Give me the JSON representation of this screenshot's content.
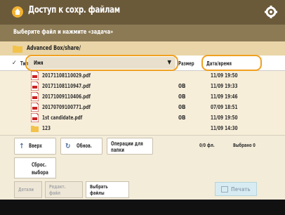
{
  "header": {
    "title": "Доступ к сохр. файлам"
  },
  "subheader": {
    "instruction": "Выберите файл и нажмите «задача»"
  },
  "path": {
    "text": "Advanced Box/share/"
  },
  "columns": {
    "type": "Тип",
    "name": "Имя",
    "sort_arrow": "▼",
    "size": "Размер",
    "date": "Дата/время"
  },
  "files": [
    {
      "name": "20171108110029.pdf",
      "size": "",
      "date": "11/09 19:50",
      "icon": "pdf-file-icon"
    },
    {
      "name": "20171108110947.pdf",
      "size": "0B",
      "date": "11/09 19:33",
      "icon": "pdf-file-icon"
    },
    {
      "name": "20171009110406.pdf",
      "size": "0B",
      "date": "11/09 19:46",
      "icon": "pdf-file-icon"
    },
    {
      "name": "20170709100771.pdf",
      "size": "0B",
      "date": "07/09 18:51",
      "icon": "pdf-file-icon"
    },
    {
      "name": "1st candidate.pdf",
      "size": "0B",
      "date": "11/09 19:50",
      "icon": "pdf-file-icon"
    },
    {
      "name": "123",
      "size": "",
      "date": "11/09 14:30",
      "icon": "folder-icon"
    }
  ],
  "toolbar": {
    "up": "Вверх",
    "refresh": "Обнов.",
    "operations": "Операции для папки",
    "selected_count": "0/0 фл.",
    "pages": "Выбрано 0"
  },
  "reset": {
    "label_line1": "Сброс.",
    "label_line2": "выбора"
  },
  "actions": {
    "details": "Детали",
    "edit_line1": "Редакт.",
    "edit_line2": "файл",
    "select_line1": "Выбрать",
    "select_line2": "файлы",
    "print": "Печать"
  },
  "colors": {
    "titlebar": "#6b5a3a",
    "subbar": "#8c7a55",
    "accent": "#f0a020",
    "background": "#f7eed9"
  }
}
